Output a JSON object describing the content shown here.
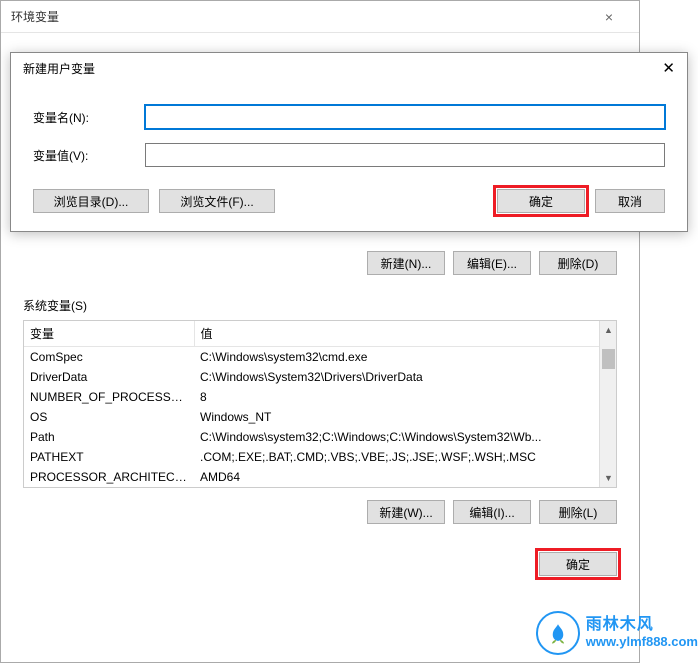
{
  "parent_window": {
    "title": "环境变量",
    "close_glyph": "×",
    "user_buttons": {
      "new": "新建(N)...",
      "edit": "编辑(E)...",
      "delete": "删除(D)"
    },
    "system_section_label": "系统变量(S)",
    "sys_table": {
      "headers": {
        "var": "变量",
        "val": "值"
      },
      "rows": [
        {
          "var": "ComSpec",
          "val": "C:\\Windows\\system32\\cmd.exe"
        },
        {
          "var": "DriverData",
          "val": "C:\\Windows\\System32\\Drivers\\DriverData"
        },
        {
          "var": "NUMBER_OF_PROCESSORS",
          "val": "8"
        },
        {
          "var": "OS",
          "val": "Windows_NT"
        },
        {
          "var": "Path",
          "val": "C:\\Windows\\system32;C:\\Windows;C:\\Windows\\System32\\Wb..."
        },
        {
          "var": "PATHEXT",
          "val": ".COM;.EXE;.BAT;.CMD;.VBS;.VBE;.JS;.JSE;.WSF;.WSH;.MSC"
        },
        {
          "var": "PROCESSOR_ARCHITECT...",
          "val": "AMD64"
        }
      ]
    },
    "sys_buttons": {
      "new": "新建(W)...",
      "edit": "编辑(I)...",
      "delete": "删除(L)"
    },
    "ok_button": "确定"
  },
  "modal": {
    "title": "新建用户变量",
    "close_glyph": "✕",
    "field_name_label": "变量名(N):",
    "field_value_label": "变量值(V):",
    "field_name_value": "",
    "field_value_value": "",
    "browse_dir": "浏览目录(D)...",
    "browse_file": "浏览文件(F)...",
    "ok": "确定",
    "cancel": "取消"
  },
  "watermark": {
    "cn": "雨林木风",
    "url": "www.ylmf888.com"
  }
}
